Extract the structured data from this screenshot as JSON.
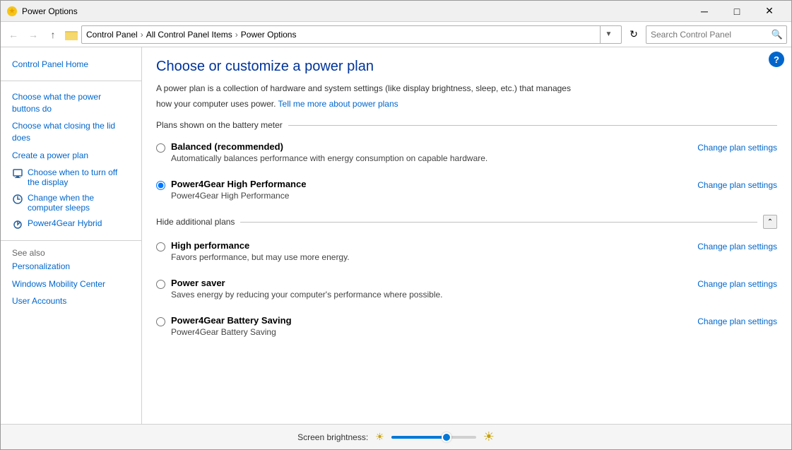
{
  "window": {
    "title": "Power Options",
    "titlebar": {
      "minimize": "─",
      "maximize": "□",
      "close": "✕"
    }
  },
  "addressbar": {
    "back": "←",
    "forward": "→",
    "up": "↑",
    "path_segments": [
      "Control Panel",
      "All Control Panel Items",
      "Power Options"
    ],
    "search_placeholder": "Search Control Panel",
    "search_label": "Search Control Panel",
    "refresh": "↻"
  },
  "sidebar": {
    "home_link": "Control Panel Home",
    "links": [
      {
        "id": "power-buttons",
        "label": "Choose what the power buttons do",
        "icon": false
      },
      {
        "id": "closing-lid",
        "label": "Choose what closing the lid does",
        "icon": false
      },
      {
        "id": "create-plan",
        "label": "Create a power plan",
        "icon": false
      },
      {
        "id": "turn-off-display",
        "label": "Choose when to turn off the display",
        "icon": true,
        "icon_color": "#2a6099"
      },
      {
        "id": "computer-sleeps",
        "label": "Change when the computer sleeps",
        "icon": true,
        "icon_color": "#2a6099"
      },
      {
        "id": "power4gear",
        "label": "Power4Gear Hybrid",
        "icon": true
      }
    ],
    "see_also_label": "See also",
    "also_links": [
      {
        "id": "personalization",
        "label": "Personalization"
      },
      {
        "id": "mobility-center",
        "label": "Windows Mobility Center"
      },
      {
        "id": "user-accounts",
        "label": "User Accounts"
      }
    ]
  },
  "content": {
    "title": "Choose or customize a power plan",
    "description1": "A power plan is a collection of hardware and system settings (like display brightness, sleep, etc.) that manages",
    "description2": "how your computer uses power.",
    "learn_more_link": "Tell me more about power plans",
    "plans_section_label": "Plans shown on the battery meter",
    "plans": [
      {
        "id": "balanced",
        "name": "Balanced (recommended)",
        "description": "Automatically balances performance with energy consumption on capable hardware.",
        "checked": false,
        "change_link": "Change plan settings"
      },
      {
        "id": "power4gear-high",
        "name": "Power4Gear High Performance",
        "description": "Power4Gear High Performance",
        "checked": true,
        "change_link": "Change plan settings"
      }
    ],
    "hide_section_label": "Hide additional plans",
    "additional_plans": [
      {
        "id": "high-perf",
        "name": "High performance",
        "description": "Favors performance, but may use more energy.",
        "checked": false,
        "change_link": "Change plan settings"
      },
      {
        "id": "power-saver",
        "name": "Power saver",
        "description": "Saves energy by reducing your computer's performance where possible.",
        "checked": false,
        "change_link": "Change plan settings"
      },
      {
        "id": "power4gear-battery",
        "name": "Power4Gear Battery Saving",
        "description": "Power4Gear Battery Saving",
        "checked": false,
        "change_link": "Change plan settings"
      }
    ]
  },
  "brightness": {
    "label": "Screen brightness:",
    "value": 65
  }
}
